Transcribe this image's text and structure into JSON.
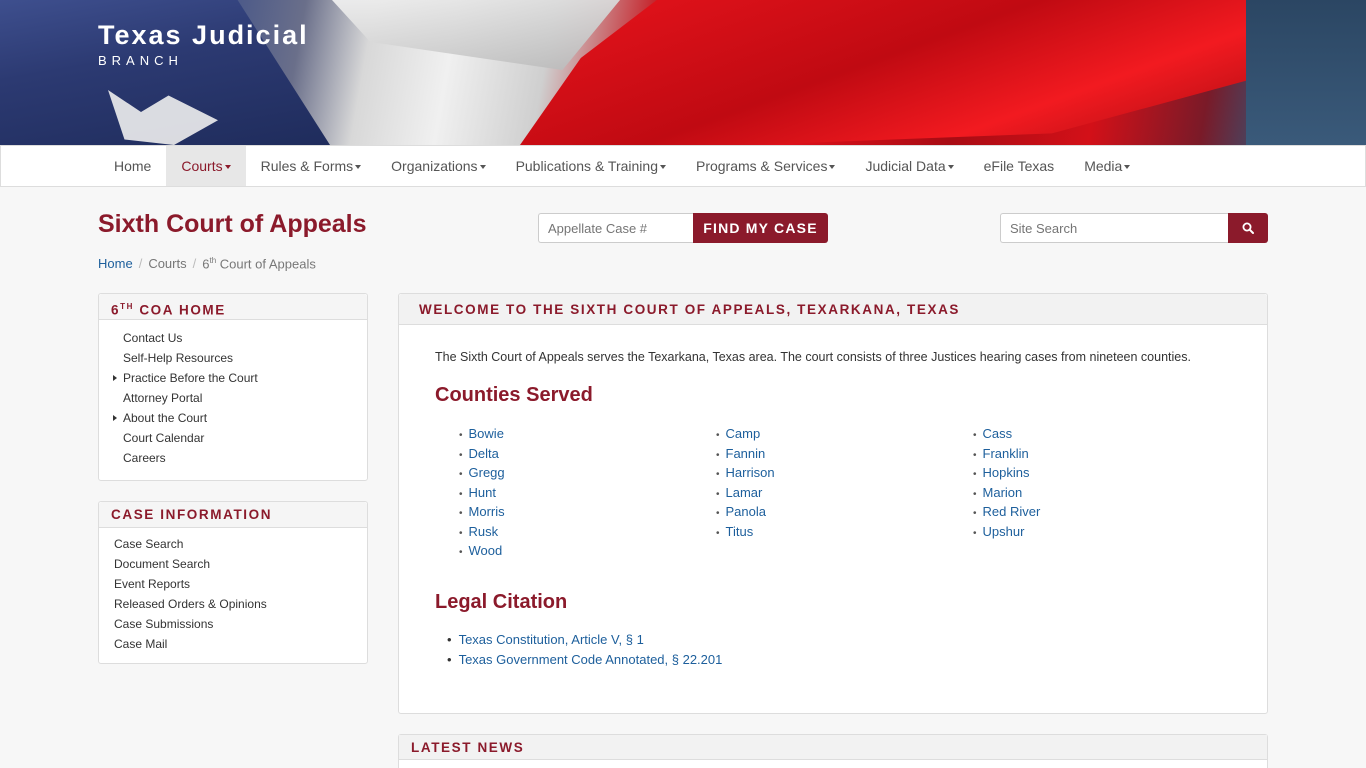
{
  "brand": {
    "title": "Texas Judicial",
    "subtitle": "BRANCH"
  },
  "nav": {
    "items": [
      {
        "label": "Home"
      },
      {
        "label": "Courts"
      },
      {
        "label": "Rules & Forms"
      },
      {
        "label": "Organizations"
      },
      {
        "label": "Publications & Training"
      },
      {
        "label": "Programs & Services"
      },
      {
        "label": "Judicial Data"
      },
      {
        "label": "eFile Texas"
      },
      {
        "label": "Media"
      }
    ]
  },
  "page": {
    "title": "Sixth Court of Appeals"
  },
  "case_search": {
    "placeholder": "Appellate Case #",
    "button": "FIND MY CASE"
  },
  "site_search": {
    "placeholder": "Site Search"
  },
  "breadcrumb": {
    "home": "Home",
    "courts": "Courts",
    "current_prefix": "6",
    "current_sup": "th",
    "current_suffix": " Court of Appeals"
  },
  "sidebar": {
    "coa": {
      "title_prefix": "6",
      "title_sup": "TH",
      "title_suffix": " COA HOME",
      "items": [
        {
          "label": "Contact Us"
        },
        {
          "label": "Self-Help Resources"
        },
        {
          "label": "Practice Before the Court"
        },
        {
          "label": "Attorney Portal"
        },
        {
          "label": "About the Court"
        },
        {
          "label": "Court Calendar"
        },
        {
          "label": "Careers"
        }
      ]
    },
    "case_info": {
      "title": "CASE INFORMATION",
      "items": [
        {
          "label": "Case Search"
        },
        {
          "label": "Document Search"
        },
        {
          "label": "Event Reports"
        },
        {
          "label": "Released Orders & Opinions"
        },
        {
          "label": "Case Submissions"
        },
        {
          "label": "Case Mail"
        }
      ]
    }
  },
  "main": {
    "heading": "WELCOME TO THE SIXTH COURT OF APPEALS, TEXARKANA, TEXAS",
    "intro": "The Sixth Court of Appeals serves the Texarkana, Texas area. The court consists of three Justices hearing cases from nineteen counties.",
    "counties_heading": "Counties Served",
    "counties": {
      "col1": [
        "Bowie",
        "Delta",
        "Gregg",
        "Hunt",
        "Morris",
        "Rusk",
        "Wood"
      ],
      "col2": [
        "Camp",
        "Fannin",
        "Harrison",
        "Lamar",
        "Panola",
        "Titus"
      ],
      "col3": [
        "Cass",
        "Franklin",
        "Hopkins",
        "Marion",
        "Red River",
        "Upshur"
      ]
    },
    "citation_heading": "Legal Citation",
    "citations": [
      "Texas Constitution, Article V, § 1",
      "Texas Government Code Annotated, § 22.201"
    ]
  },
  "news": {
    "heading": "LATEST NEWS"
  },
  "colors": {
    "accent": "#8b1a2b",
    "link": "#1d5f9c"
  }
}
